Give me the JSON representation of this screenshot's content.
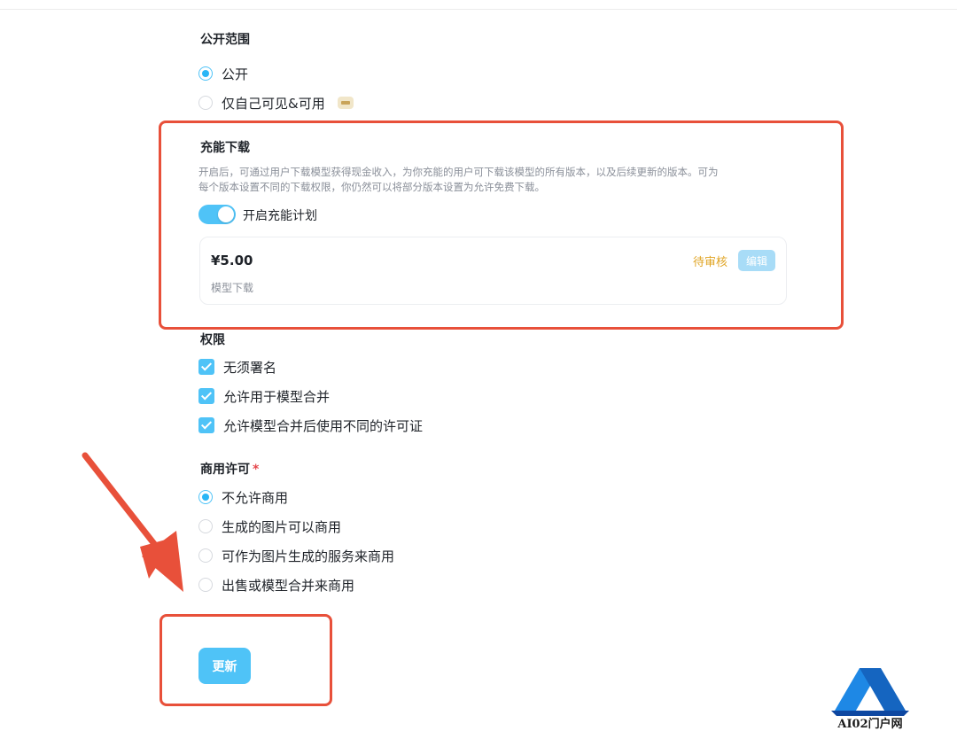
{
  "visibility": {
    "title": "公开范围",
    "options": [
      "公开",
      "仅自己可见&可用"
    ],
    "selected": 0
  },
  "charge_download": {
    "title": "充能下载",
    "description_line1": "开启后，可通过用户下载模型获得现金收入，为你充能的用户可下载该模型的所有版本，以及后续更新的版本。可为",
    "description_line2": "每个版本设置不同的下载权限，你仍然可以将部分版本设置为允许免费下载。",
    "toggle_label": "开启充能计划",
    "toggle_on": true,
    "card": {
      "price": "¥5.00",
      "subtitle": "模型下载",
      "status": "待审核",
      "edit_label": "编辑"
    }
  },
  "permissions": {
    "title": "权限",
    "items": [
      "无须署名",
      "允许用于模型合并",
      "允许模型合并后使用不同的许可证"
    ],
    "checked": [
      true,
      true,
      true
    ]
  },
  "commercial": {
    "title": "商用许可",
    "required_mark": "*",
    "options": [
      "不允许商用",
      "生成的图片可以商用",
      "可作为图片生成的服务来商用",
      "出售或模型合并来商用"
    ],
    "selected": 0
  },
  "update_label": "更新",
  "watermark": "AI02门户网",
  "colors": {
    "accent": "#4fc3f7",
    "highlight_box": "#e8503a",
    "pending": "#e0a526"
  }
}
